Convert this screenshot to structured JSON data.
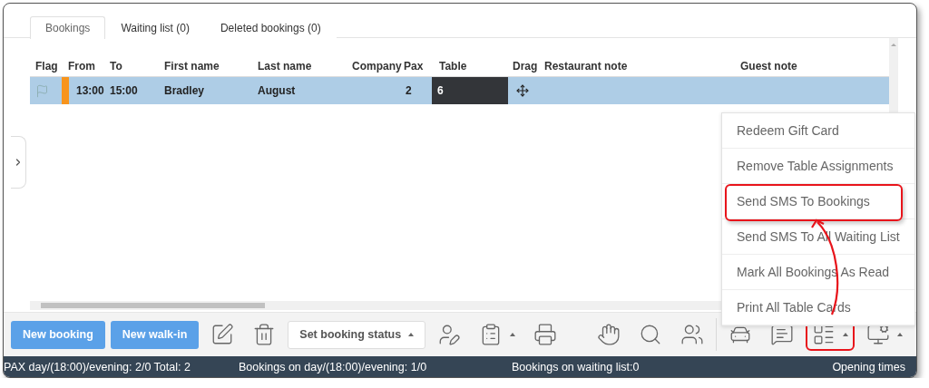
{
  "tabs": [
    {
      "label": "Bookings",
      "selected": true
    },
    {
      "label": "Waiting list (0)",
      "selected": false
    },
    {
      "label": "Deleted bookings (0)",
      "selected": false
    }
  ],
  "table": {
    "columns": [
      "Flag",
      "From",
      "To",
      "First name",
      "Last name",
      "Company",
      "Pax",
      "Table",
      "Drag",
      "Restaurant note",
      "Guest note"
    ],
    "rows": [
      {
        "selected": true,
        "color": "#f7941d",
        "from": "13:00",
        "to": "15:00",
        "first_name": "Bradley",
        "last_name": "August",
        "company": "",
        "pax": "2",
        "table": "6"
      }
    ]
  },
  "menu": {
    "items": [
      {
        "label": "Redeem Gift Card",
        "highlighted": false
      },
      {
        "label": "Remove Table Assignments",
        "highlighted": false
      },
      {
        "label": "Send SMS To Bookings",
        "highlighted": true
      },
      {
        "label": "Send SMS To All Waiting List",
        "highlighted": false
      },
      {
        "label": "Mark All Bookings As Read",
        "highlighted": false
      },
      {
        "label": "Print All Table Cards",
        "highlighted": false
      }
    ]
  },
  "toolbar": [
    {
      "kind": "primary",
      "label": "New booking"
    },
    {
      "kind": "primary",
      "label": "New walk-in"
    },
    {
      "kind": "icon",
      "caret": false,
      "highlighted": false
    },
    {
      "kind": "icon",
      "caret": false,
      "highlighted": false
    },
    {
      "kind": "select",
      "label": "Set booking status"
    },
    {
      "kind": "icon",
      "caret": false,
      "highlighted": false
    },
    {
      "kind": "icon",
      "caret": true,
      "highlighted": false
    },
    {
      "kind": "icon",
      "caret": false,
      "highlighted": false
    },
    {
      "kind": "spacer"
    },
    {
      "kind": "icon",
      "caret": false,
      "highlighted": false
    },
    {
      "kind": "icon",
      "caret": false,
      "highlighted": false
    },
    {
      "kind": "icon",
      "caret": false,
      "highlighted": false
    },
    {
      "kind": "separator"
    },
    {
      "kind": "icon",
      "caret": false,
      "highlighted": false
    },
    {
      "kind": "icon",
      "caret": false,
      "highlighted": false
    },
    {
      "kind": "icon",
      "caret": true,
      "highlighted": true
    },
    {
      "kind": "icon",
      "caret": true,
      "highlighted": false
    }
  ],
  "status_bar": [
    "PAX day/(18:00)/evening: 2/0 Total: 2",
    "Bookings on day/(18:00)/evening: 1/0",
    "Bookings on waiting list:0",
    "Opening times"
  ]
}
